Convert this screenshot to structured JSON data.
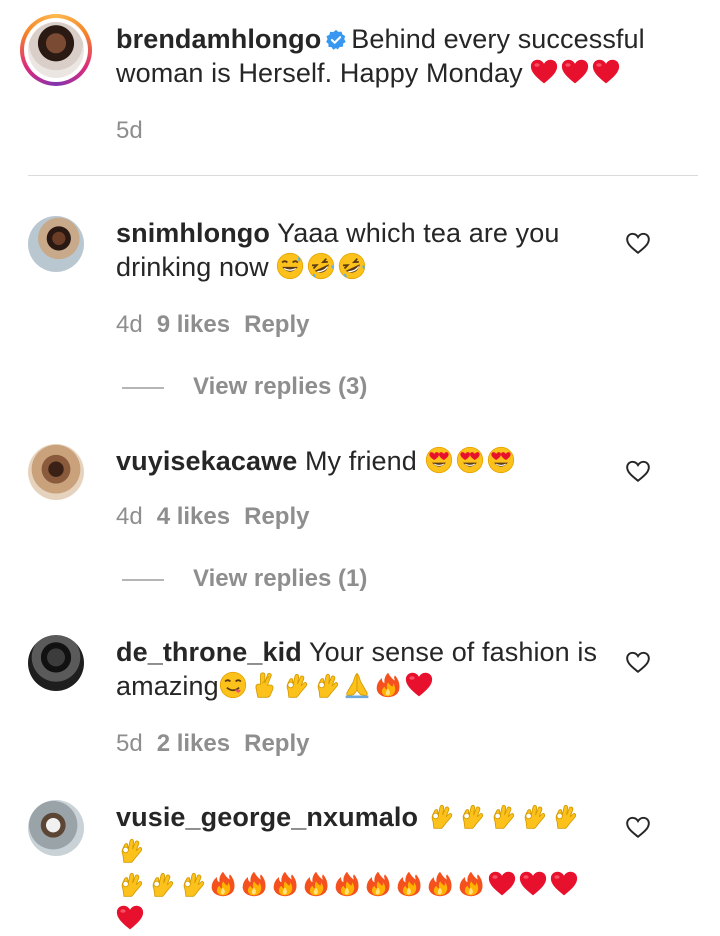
{
  "caption": {
    "username": "brendamhlongo",
    "text": "Behind every successful woman is Herself. Happy Monday",
    "emojis": [
      "red-heart",
      "red-heart",
      "red-heart"
    ],
    "time": "5d"
  },
  "comments": [
    {
      "username": "snimhlongo",
      "text": "Yaaa which tea are you drinking now",
      "emojis": [
        "grinning-sweat",
        "rofl",
        "rofl"
      ],
      "time": "4d",
      "likes": "9 likes",
      "reply": "Reply",
      "view_replies": "View replies (3)"
    },
    {
      "username": "vuyisekacawe",
      "text": "My friend",
      "emojis": [
        "heart-eyes",
        "heart-eyes",
        "heart-eyes"
      ],
      "time": "4d",
      "likes": "4 likes",
      "reply": "Reply",
      "view_replies": "View replies (1)"
    },
    {
      "username": "de_throne_kid",
      "text": "Your sense of fashion is amazing",
      "emojis": [
        "yum",
        "crossed-fingers",
        "ok-hand",
        "ok-hand",
        "folded-hands",
        "fire",
        "red-heart"
      ],
      "time": "5d",
      "likes": "2 likes",
      "reply": "Reply"
    },
    {
      "username": "vusie_george_nxumalo",
      "emojis_line1": [
        "ok-hand",
        "ok-hand",
        "ok-hand",
        "ok-hand",
        "ok-hand",
        "ok-hand"
      ],
      "emojis_line2": [
        "ok-hand",
        "ok-hand",
        "ok-hand",
        "fire",
        "fire",
        "fire",
        "fire",
        "fire",
        "fire",
        "fire",
        "fire",
        "fire",
        "red-heart",
        "red-heart",
        "red-heart"
      ],
      "emojis_line3": [
        "red-heart"
      ]
    }
  ],
  "colors": {
    "text": "#262626",
    "secondary": "#8e8e8e",
    "verified": "#3897f0",
    "heart": "#ed1c24"
  }
}
